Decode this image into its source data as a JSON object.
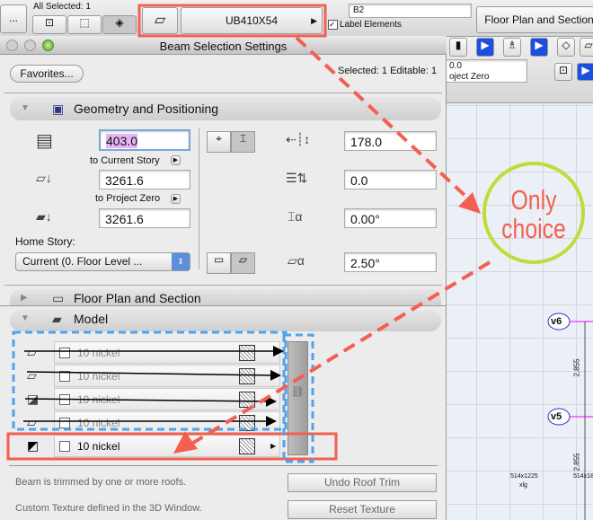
{
  "toolbar": {
    "selection_info": "All Selected: 1",
    "beam_profile": "UB410X54",
    "id_value": "B2",
    "label_elements": "Label Elements",
    "label_checked": true,
    "floor_plan_button": "Floor Plan and Section",
    "ellipsis": "..."
  },
  "dialog": {
    "title": "Beam Selection Settings",
    "favorites": "Favorites...",
    "selected_info": "Selected: 1 Editable: 1"
  },
  "geometry": {
    "header": "Geometry and Positioning",
    "height": "403.0",
    "to_current_story": "to Current Story",
    "current_story_value": "3261.6",
    "to_project_zero": "to Project Zero",
    "project_zero_value": "3261.6",
    "home_story_label": "Home Story:",
    "home_story_value": "Current (0. Floor Level ...",
    "width": "178.0",
    "offset": "0.0",
    "rotation": "0.00°",
    "slant": "2.50°"
  },
  "floor_plan": {
    "header": "Floor Plan and Section"
  },
  "model": {
    "header": "Model",
    "surfaces": [
      {
        "label": "10 nickel",
        "enabled": false
      },
      {
        "label": "10 nickel",
        "enabled": false
      },
      {
        "label": "10 nickel",
        "enabled": false
      },
      {
        "label": "10 nickel",
        "enabled": false
      },
      {
        "label": "10 nickel",
        "enabled": true
      }
    ],
    "roof_trim_text": "Beam is trimmed by one or more roofs.",
    "undo_roof_trim": "Undo Roof Trim",
    "texture_text": "Custom Texture defined in the 3D Window.",
    "reset_texture": "Reset Texture"
  },
  "right_panel": {
    "elevation_value": "0.0",
    "elevation_ref": "oject Zero",
    "markers": [
      "v6",
      "v5"
    ],
    "dimensions": [
      "2,855",
      "2,855"
    ],
    "bottom_labels": [
      "514x1225",
      "xlg",
      "514x18"
    ]
  },
  "annotation": {
    "callout": "Only",
    "callout2": "choice",
    "highlight_color": "#f26052",
    "callout_circle_color": "#c4d93a",
    "dashed_box_color": "#4da3f0"
  }
}
